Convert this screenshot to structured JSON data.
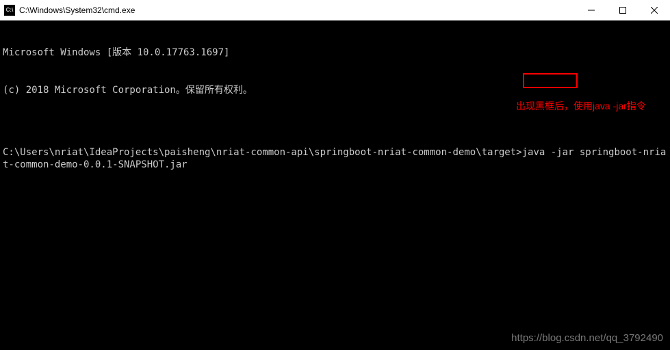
{
  "titlebar": {
    "icon_text": "C:\\",
    "title": "C:\\Windows\\System32\\cmd.exe"
  },
  "terminal": {
    "line1": "Microsoft Windows [版本 10.0.17763.1697]",
    "line2": "(c) 2018 Microsoft Corporation。保留所有权利。",
    "line3": "",
    "prompt": "C:\\Users\\nriat\\IdeaProjects\\paisheng\\nriat-common-api\\springboot-nriat-common-demo\\target>",
    "command": "java -jar springboot-nriat-common-demo-0.0.1-SNAPSHOT.jar"
  },
  "annotation": {
    "text": "出现黑框后，使用java -jar指令"
  },
  "watermark": {
    "text": "https://blog.csdn.net/qq_3792490"
  }
}
